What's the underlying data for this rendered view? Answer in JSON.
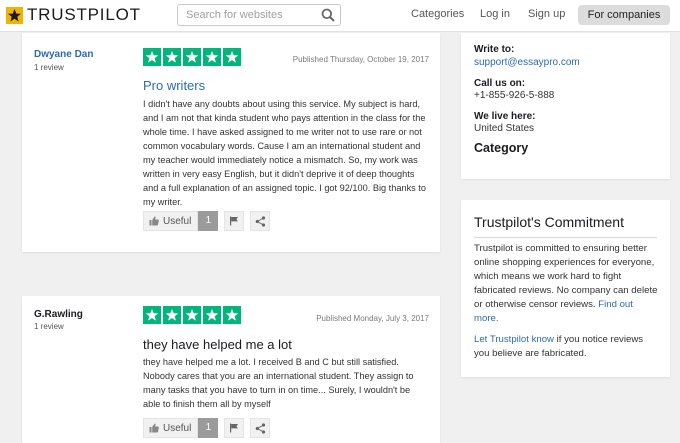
{
  "header": {
    "logo_text": "TRUSTPILOT",
    "search_placeholder": "Search for websites",
    "nav": {
      "categories": "Categories",
      "login": "Log in",
      "signup": "Sign up"
    },
    "for_companies": "For companies"
  },
  "reviews": [
    {
      "name": "Dwyane Dan",
      "review_count": "1 review",
      "rating": 5,
      "published": "Published Thursday, October 19, 2017",
      "title": "Pro writers",
      "body": "I didn't have any doubts about using this service. My subject is hard, and I am not that kinda student who pays attention in the class for the whole time. I have asked assigned to me writer not to use rare or not common vocabulary words. Cause I am an international student and my teacher would immediately notice a mismatch. So, my work was written in very easy English, but it didn't deprive it of deep thoughts and a full explanation of an assigned topic. I got 92/100. Big thanks to my writer.",
      "useful_label": "Useful",
      "useful_count": "1"
    },
    {
      "name": "G.Rawling",
      "review_count": "1 review",
      "rating": 5,
      "published": "Published Monday, July 3, 2017",
      "title": "they have helped me a lot",
      "body": "they have helped me a lot. I received B and C but still satisfied. Nobody cares that you are an international student. They assign to many tasks that you have to turn in on time... Surely, I wouldn't be able to finish them all by myself",
      "useful_label": "Useful",
      "useful_count": "1"
    }
  ],
  "contact": {
    "write_to_label": "Write to:",
    "write_to_value": "support@essaypro.com",
    "call_label": "Call us on:",
    "call_value": "+1-855-926-5-888",
    "live_label": "We live here:",
    "live_value": "United States",
    "category_label": "Category"
  },
  "commitment": {
    "title": "Trustpilot's Commitment",
    "text": "Trustpilot is committed to ensuring better online shopping experiences for everyone, which means we work hard to fight fabricated reviews. No company can delete or otherwise censor reviews.",
    "find_out_more": "Find out more.",
    "let_link": "Let Trustpilot know",
    "let_text": " if you notice reviews you believe are fabricated."
  },
  "colors": {
    "star_green": "#00b67a",
    "link_blue": "#2b6cb0",
    "logo_star": "#f0b400"
  },
  "icons": [
    "trustpilot-star-icon",
    "search-icon",
    "star-icon",
    "thumbs-up-icon",
    "flag-icon",
    "share-icon"
  ]
}
